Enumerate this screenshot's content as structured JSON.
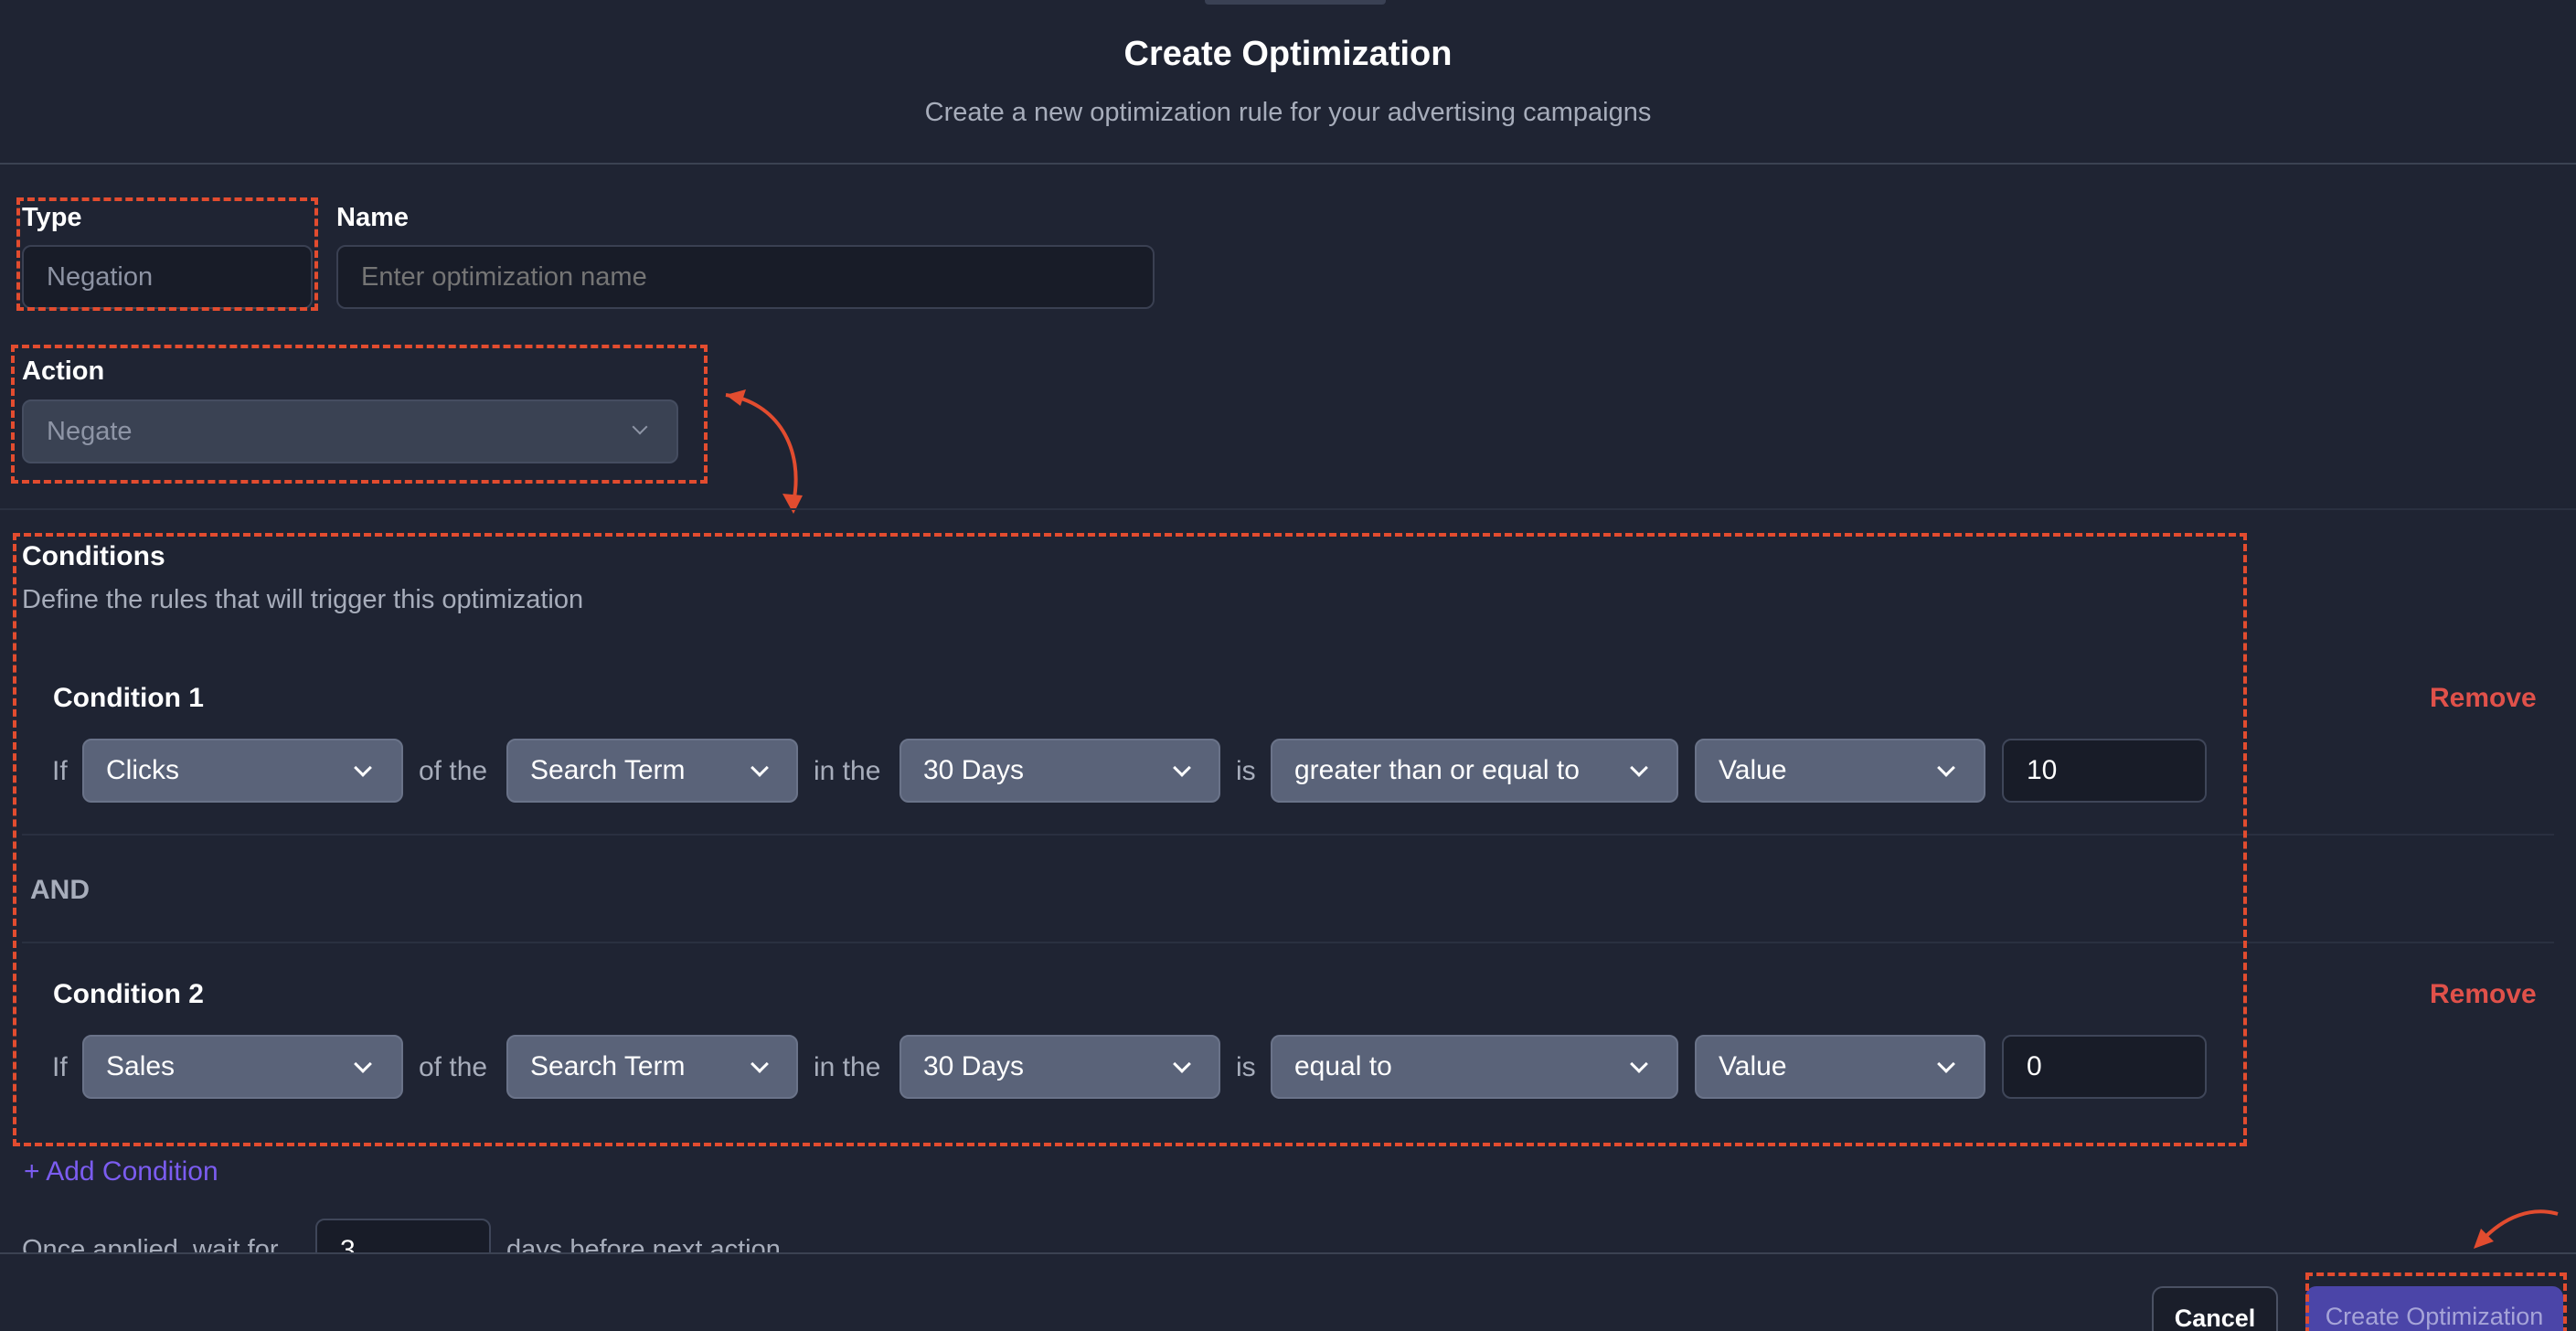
{
  "header": {
    "title": "Create Optimization",
    "subtitle": "Create a new optimization rule for your advertising campaigns"
  },
  "type_field": {
    "label": "Type",
    "value": "Negation"
  },
  "name_field": {
    "label": "Name",
    "placeholder": "Enter optimization name"
  },
  "action_field": {
    "label": "Action",
    "value": "Negate"
  },
  "conditions": {
    "title": "Conditions",
    "description": "Define the rules that will trigger this optimization",
    "joiner": "AND",
    "words": {
      "if": "If",
      "of_the": "of the",
      "in_the": "in the",
      "is": "is"
    },
    "items": [
      {
        "title": "Condition 1",
        "remove_label": "Remove",
        "metric": "Clicks",
        "entity": "Search Term",
        "period": "30 Days",
        "operator": "greater than or equal to",
        "value_type": "Value",
        "value": "10"
      },
      {
        "title": "Condition 2",
        "remove_label": "Remove",
        "metric": "Sales",
        "entity": "Search Term",
        "period": "30 Days",
        "operator": "equal to",
        "value_type": "Value",
        "value": "0"
      }
    ],
    "add_label": "+ Add Condition"
  },
  "wait": {
    "prefix": "Once applied, wait for",
    "value": "3",
    "suffix": "days before next action"
  },
  "footer": {
    "cancel_label": "Cancel",
    "create_label": "Create Optimization"
  },
  "colors": {
    "background": "#1f2433",
    "annotation": "#e24c2f",
    "accent": "#7b5cf0",
    "danger": "#e0514a"
  }
}
